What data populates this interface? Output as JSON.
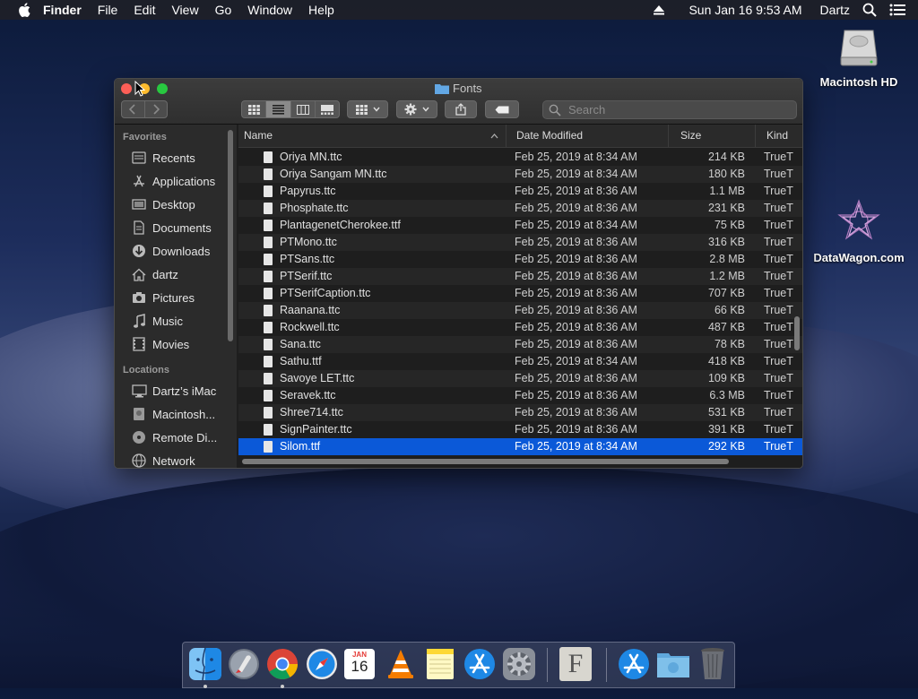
{
  "menubar": {
    "items": [
      "Finder",
      "File",
      "Edit",
      "View",
      "Go",
      "Window",
      "Help"
    ],
    "datetime": "Sun Jan 16  9:53 AM",
    "user": "Dartz"
  },
  "desktop": {
    "icons": [
      {
        "label": "Macintosh HD",
        "icon": "hard-drive-icon"
      },
      {
        "label": "DataWagon.com",
        "icon": "datawagon-logo-icon"
      }
    ]
  },
  "window": {
    "title": "Fonts",
    "search_placeholder": "Search",
    "sidebar": {
      "favorites_heading": "Favorites",
      "favorites": [
        {
          "label": "Recents",
          "icon": "recents-icon"
        },
        {
          "label": "Applications",
          "icon": "applications-icon"
        },
        {
          "label": "Desktop",
          "icon": "desktop-icon"
        },
        {
          "label": "Documents",
          "icon": "documents-icon"
        },
        {
          "label": "Downloads",
          "icon": "downloads-icon"
        },
        {
          "label": "dartz",
          "icon": "home-icon"
        },
        {
          "label": "Pictures",
          "icon": "pictures-icon"
        },
        {
          "label": "Music",
          "icon": "music-icon"
        },
        {
          "label": "Movies",
          "icon": "movies-icon"
        }
      ],
      "locations_heading": "Locations",
      "locations": [
        {
          "label": "Dartz’s iMac",
          "icon": "imac-icon"
        },
        {
          "label": "Macintosh...",
          "icon": "disk-icon"
        },
        {
          "label": "Remote Di...",
          "icon": "remote-disc-icon"
        },
        {
          "label": "Network",
          "icon": "network-icon"
        }
      ]
    },
    "columns": {
      "name": "Name",
      "date": "Date Modified",
      "size": "Size",
      "kind": "Kind"
    },
    "files": [
      {
        "name": "Oriya MN.ttc",
        "date": "Feb 25, 2019 at 8:34 AM",
        "size": "214 KB",
        "kind": "TrueT"
      },
      {
        "name": "Oriya Sangam MN.ttc",
        "date": "Feb 25, 2019 at 8:34 AM",
        "size": "180 KB",
        "kind": "TrueT"
      },
      {
        "name": "Papyrus.ttc",
        "date": "Feb 25, 2019 at 8:36 AM",
        "size": "1.1 MB",
        "kind": "TrueT"
      },
      {
        "name": "Phosphate.ttc",
        "date": "Feb 25, 2019 at 8:36 AM",
        "size": "231 KB",
        "kind": "TrueT"
      },
      {
        "name": "PlantagenetCherokee.ttf",
        "date": "Feb 25, 2019 at 8:34 AM",
        "size": "75 KB",
        "kind": "TrueT"
      },
      {
        "name": "PTMono.ttc",
        "date": "Feb 25, 2019 at 8:36 AM",
        "size": "316 KB",
        "kind": "TrueT"
      },
      {
        "name": "PTSans.ttc",
        "date": "Feb 25, 2019 at 8:36 AM",
        "size": "2.8 MB",
        "kind": "TrueT"
      },
      {
        "name": "PTSerif.ttc",
        "date": "Feb 25, 2019 at 8:36 AM",
        "size": "1.2 MB",
        "kind": "TrueT"
      },
      {
        "name": "PTSerifCaption.ttc",
        "date": "Feb 25, 2019 at 8:36 AM",
        "size": "707 KB",
        "kind": "TrueT"
      },
      {
        "name": "Raanana.ttc",
        "date": "Feb 25, 2019 at 8:36 AM",
        "size": "66 KB",
        "kind": "TrueT"
      },
      {
        "name": "Rockwell.ttc",
        "date": "Feb 25, 2019 at 8:36 AM",
        "size": "487 KB",
        "kind": "TrueT"
      },
      {
        "name": "Sana.ttc",
        "date": "Feb 25, 2019 at 8:36 AM",
        "size": "78 KB",
        "kind": "TrueT"
      },
      {
        "name": "Sathu.ttf",
        "date": "Feb 25, 2019 at 8:34 AM",
        "size": "418 KB",
        "kind": "TrueT"
      },
      {
        "name": "Savoye LET.ttc",
        "date": "Feb 25, 2019 at 8:36 AM",
        "size": "109 KB",
        "kind": "TrueT"
      },
      {
        "name": "Seravek.ttc",
        "date": "Feb 25, 2019 at 8:36 AM",
        "size": "6.3 MB",
        "kind": "TrueT"
      },
      {
        "name": "Shree714.ttc",
        "date": "Feb 25, 2019 at 8:36 AM",
        "size": "531 KB",
        "kind": "TrueT"
      },
      {
        "name": "SignPainter.ttc",
        "date": "Feb 25, 2019 at 8:36 AM",
        "size": "391 KB",
        "kind": "TrueT"
      },
      {
        "name": "Silom.ttf",
        "date": "Feb 25, 2019 at 8:34 AM",
        "size": "292 KB",
        "kind": "TrueT",
        "selected": true
      }
    ],
    "selection_color": "#0b59d8"
  },
  "dock": {
    "apps": [
      "finder-icon",
      "launchpad-icon",
      "chrome-icon",
      "safari-icon",
      "calendar-icon",
      "vlc-icon",
      "notes-icon",
      "app-store-icon",
      "system-preferences-icon",
      "font-book-icon",
      "app-store-folder-icon",
      "downloads-folder-icon",
      "trash-icon"
    ],
    "calendar": {
      "month": "JAN",
      "day": "16"
    },
    "fontbook_letter": "F"
  }
}
